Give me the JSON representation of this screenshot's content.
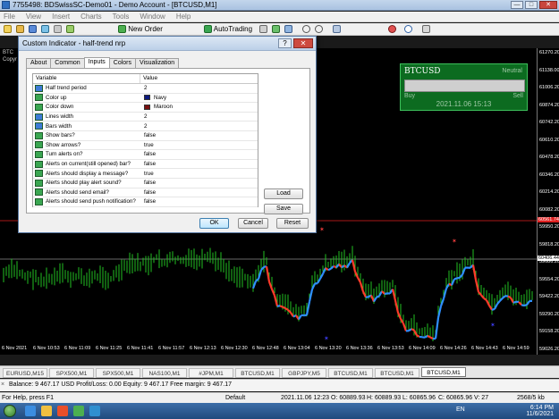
{
  "window": {
    "title": "7755498: BDSwissSC-Demo01 - Demo Account - [BTCUSD,M1]",
    "controls": [
      "—",
      "□",
      "✕"
    ]
  },
  "menu": [
    "File",
    "View",
    "Insert",
    "Charts",
    "Tools",
    "Window",
    "Help"
  ],
  "toolbar": {
    "new_order": "New Order",
    "autotrading": "AutoTrading"
  },
  "chart_header": {
    "symbol": "BTC",
    "copy": "Copyr"
  },
  "quote_panel": {
    "symbol": "BTCUSD",
    "status": "Neutral",
    "buy": "Buy",
    "sell": "Sell",
    "datetime": "2021.11.06 15:13"
  },
  "price_axis": [
    "61270.20",
    "61138.00",
    "61006.20",
    "60874.20",
    "60742.20",
    "60610.20",
    "60478.20",
    "60346.20",
    "60214.20",
    "60082.20",
    "59950.20",
    "59818.20",
    "59686.20",
    "59554.20",
    "59422.20",
    "59290.20",
    "59158.20",
    "59026.20"
  ],
  "price_highlights": {
    "red": "60561.74",
    "white": "60406.44"
  },
  "time_axis": [
    "6 Nov 2021",
    "6 Nov 10:53",
    "6 Nov 11:09",
    "6 Nov 11:25",
    "6 Nov 11:41",
    "6 Nov 11:57",
    "6 Nov 12:13",
    "6 Nov 12:30",
    "6 Nov 12:48",
    "6 Nov 13:04",
    "6 Nov 13:20",
    "6 Nov 13:36",
    "6 Nov 13:53",
    "6 Nov 14:09",
    "6 Nov 14:26",
    "6 Nov 14:43",
    "6 Nov 14:59"
  ],
  "chart_tabs": [
    "EURUSD,M15",
    "SPX500,M1",
    "SPX500,M1",
    "NAS100,M1",
    "#JPM,M1",
    "BTCUSD,M1",
    "GBPJPY,M5",
    "BTCUSD,M1",
    "BTCUSD,M1",
    "BTCUSD,M1"
  ],
  "active_chart_tab": 9,
  "terminal": {
    "close": "×",
    "summary": "Balance: 9 467.17 USD  Profit/Loss: 0.00  Equity: 9 467.17  Free margin: 9 467.17"
  },
  "statusbar": {
    "help": "For Help, press F1",
    "profile": "Default",
    "datetime": "2021.11.06 12:23",
    "open": "O: 60889.93",
    "high": "H: 60889.93",
    "low": "L: 60865.96",
    "close": "C: 60865.96",
    "volume": "V: 27",
    "traffic": "2568/5 kb"
  },
  "taskbar": {
    "lang": "EN",
    "time": "6:14 PM",
    "date": "11/6/2021"
  },
  "dialog": {
    "title": "Custom Indicator - half-trend nrp",
    "help": "?",
    "close": "✕",
    "tabs": [
      "About",
      "Common",
      "Inputs",
      "Colors",
      "Visualization"
    ],
    "active_tab": 2,
    "columns": {
      "variable": "Variable",
      "value": "Value"
    },
    "inputs": [
      {
        "icon": "int",
        "label": "Half trend period",
        "value": "2"
      },
      {
        "icon": "color",
        "label": "Color up",
        "value": "Navy",
        "swatch": "#0d1a80"
      },
      {
        "icon": "color",
        "label": "Color down",
        "value": "Maroon",
        "swatch": "#7a1010"
      },
      {
        "icon": "int",
        "label": "Lines width",
        "value": "2"
      },
      {
        "icon": "int",
        "label": "Bars width",
        "value": "2"
      },
      {
        "icon": "bool",
        "label": "Show bars?",
        "value": "false"
      },
      {
        "icon": "bool",
        "label": "Show arrows?",
        "value": "true"
      },
      {
        "icon": "bool",
        "label": "Turn alerts on?",
        "value": "false"
      },
      {
        "icon": "bool",
        "label": "Alerts on current(still opened) bar?",
        "value": "false"
      },
      {
        "icon": "bool",
        "label": "Alerts should display a message?",
        "value": "true"
      },
      {
        "icon": "bool",
        "label": "Alerts should play alert sound?",
        "value": "false"
      },
      {
        "icon": "bool",
        "label": "Alerts should send email?",
        "value": "false"
      },
      {
        "icon": "bool",
        "label": "Alerts should send push notification?",
        "value": "false"
      }
    ],
    "load": "Load",
    "save": "Save",
    "ok": "OK",
    "cancel": "Cancel",
    "reset": "Reset"
  },
  "colors": {
    "chart_bg": "#000000",
    "bar_color": "#22c022",
    "trend_up": "#2f8fff",
    "trend_down": "#ff3a2a",
    "panel_bg": "#0c6b20"
  }
}
